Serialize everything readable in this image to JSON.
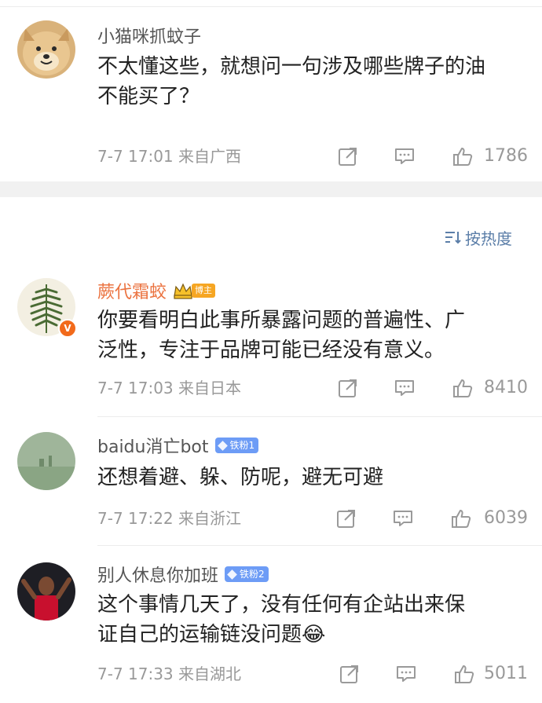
{
  "comments_top": {
    "user": "小猫咪抓蚊子",
    "text_lines": [
      "不太懂这些，就想问一句涉及哪些牌子的油",
      "不能买了？"
    ],
    "time_loc": "7-7 17:01  来自广西",
    "likes": "1786"
  },
  "sort": {
    "label": "按热度",
    "icon": "sort-lines-icon"
  },
  "comments": [
    {
      "user": "蕨代霜蛟",
      "badge": "博主",
      "text_lines": [
        "你要看明白此事所暴露问题的普遍性、广",
        "泛性，专注于品牌可能已经没有意义。"
      ],
      "time_loc": "7-7 17:03  来自日本",
      "likes": "8410",
      "verified": "V"
    },
    {
      "user": "baidu消亡bot",
      "badge": "铁粉1",
      "text_lines": [
        "还想着避、躲、防呢，避无可避"
      ],
      "time_loc": "7-7 17:22  来自浙江",
      "likes": "6039"
    },
    {
      "user": "别人休息你加班",
      "badge": "铁粉2",
      "text_lines": [
        "这个事情几天了，没有任何有企站出来保",
        "证自己的运输链没问题😂"
      ],
      "time_loc": "7-7 17:33  来自湖北",
      "likes": "5011"
    }
  ],
  "colors": {
    "accent_blue": "#5b7ea8",
    "badge_blue": "#6d9cf6",
    "name_orange": "#eb7340",
    "meta_gray": "#999999"
  },
  "icons": [
    "share-icon",
    "comment-icon",
    "like-icon"
  ]
}
